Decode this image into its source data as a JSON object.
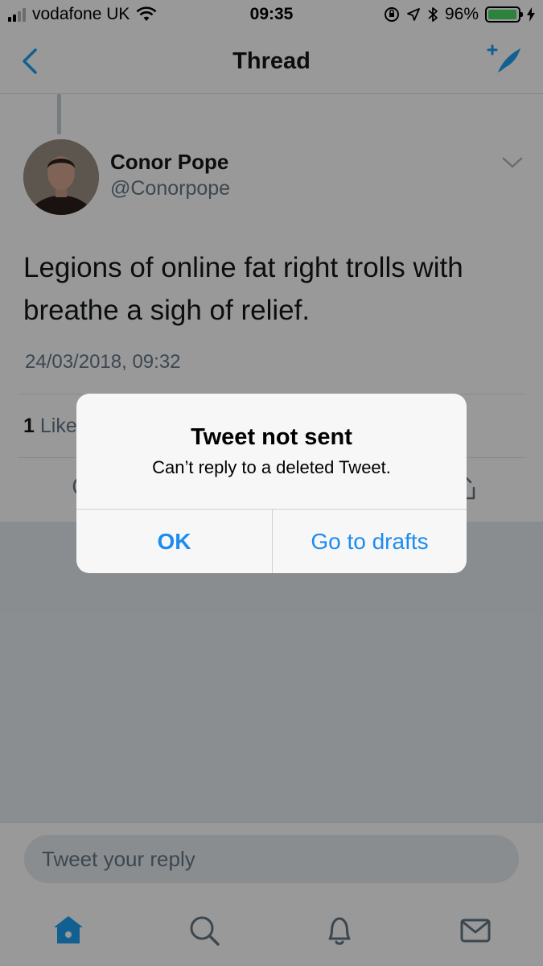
{
  "status_bar": {
    "carrier": "vodafone UK",
    "time": "09:35",
    "battery": "96%",
    "battery_level": 0.96
  },
  "nav": {
    "title": "Thread",
    "back_icon": "chevron-left-icon",
    "compose_icon": "compose-quill-icon"
  },
  "tweet": {
    "author_name": "Conor Pope",
    "author_handle": "@Conorpope",
    "text": "Legions of online fat right trolls with breathe a sigh of relief.",
    "timestamp": "24/03/2018, 09:32",
    "likes_count": "1",
    "likes_label": "Like"
  },
  "reply": {
    "placeholder": "Tweet your reply"
  },
  "tabbar": {
    "tabs": [
      "home-icon",
      "search-icon",
      "notifications-bell-icon",
      "messages-envelope-icon"
    ],
    "active_color": "#1da1f2"
  },
  "alert": {
    "title": "Tweet not sent",
    "message": "Can’t reply to a deleted Tweet.",
    "ok_label": "OK",
    "drafts_label": "Go to drafts",
    "button_color": "#1d8cf0"
  }
}
